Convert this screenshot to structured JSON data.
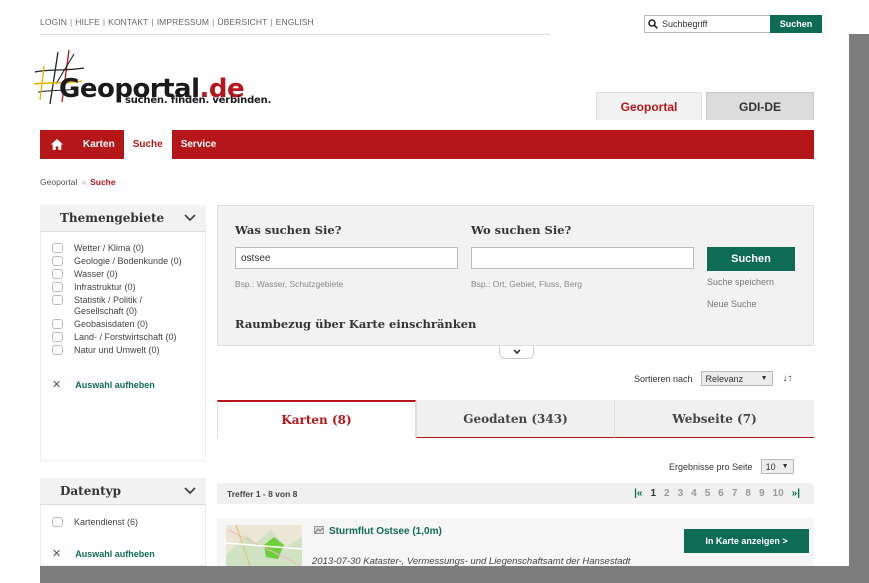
{
  "topnav": {
    "items": [
      "LOGIN",
      "HILFE",
      "KONTAKT",
      "IMPRESSUM",
      "ÜBERSICHT",
      "ENGLISH"
    ],
    "separator": "|"
  },
  "top_search": {
    "placeholder": "Suchbegriff",
    "button": "Suchen",
    "icon": "search-icon"
  },
  "logo": {
    "name_main": "Geoportal",
    "name_tld": ".de",
    "slogan": "suchen. finden. verbinden."
  },
  "portal_tabs": [
    "Geoportal",
    "GDI-DE"
  ],
  "mainnav": {
    "home_icon": "home-icon",
    "items": [
      "Karten",
      "Suche",
      "Service"
    ],
    "active": "Suche"
  },
  "breadcrumb": {
    "root": "Geoportal",
    "separator": "»",
    "current": "Suche"
  },
  "themengebiete": {
    "title": "Themengebiete",
    "options": [
      "Wetter / Klima (0)",
      "Geologie / Bodenkunde (0)",
      "Wasser (0)",
      "Infrastruktur (0)",
      "Statistik / Politik / Gesellschaft (0)",
      "Geobasisdaten (0)",
      "Land- / Forstwirtschaft (0)",
      "Natur und Umwelt (0)"
    ],
    "clear_label": "Auswahl aufheben"
  },
  "datentyp": {
    "title": "Datentyp",
    "options": [
      "Kartendienst (6)"
    ],
    "clear_label": "Auswahl aufheben"
  },
  "search_panel": {
    "what_heading": "Was suchen Sie?",
    "what_value": "ostsee",
    "what_hint": "Bsp.: Wasser, Schutzgebiete",
    "where_heading": "Wo suchen Sie?",
    "where_value": "",
    "where_hint": "Bsp.: Ort, Gebiet, Fluss, Berg",
    "search_button": "Suchen",
    "save_search": "Suche speichern",
    "new_search": "Neue Suche",
    "map_restrict": "Raumbezug über Karte einschränken"
  },
  "sort": {
    "label": "Sortieren nach",
    "value": "Relevanz",
    "order_icon": "sort-order-icon"
  },
  "result_tabs": [
    "Karten (8)",
    "Geodaten (343)",
    "Webseite (7)"
  ],
  "per_page": {
    "label": "Ergebnisse pro Seite",
    "value": "10"
  },
  "results_bar": {
    "count": "Treffer 1 - 8 von 8",
    "first": "|«",
    "last": "»|",
    "pages": [
      "1",
      "2",
      "3",
      "4",
      "5",
      "6",
      "7",
      "8",
      "9",
      "10"
    ],
    "current_page": "1"
  },
  "result_item": {
    "title": "Sturmflut Ostsee (1,0m)",
    "description": "2013-07-30 Kataster-, Vermessungs- und Liegenschaftsamt der Hansestadt",
    "button": "In Karte anzeigen >",
    "type_icon": "map-service-icon"
  },
  "colors": {
    "brand_red": "#b5161a",
    "action_green": "#0e6b55",
    "panel_gray": "#f2f2f2"
  }
}
